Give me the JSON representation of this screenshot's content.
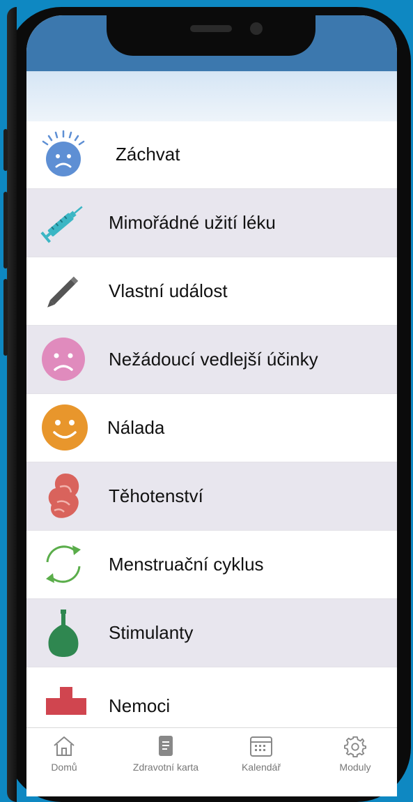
{
  "list": {
    "items": [
      {
        "label": "Záchvat",
        "icon": "seizure-face-icon"
      },
      {
        "label": "Mimořádné užití léku",
        "icon": "syringe-icon"
      },
      {
        "label": "Vlastní událost",
        "icon": "pencil-icon"
      },
      {
        "label": "Nežádoucí vedlejší účinky",
        "icon": "sad-face-icon"
      },
      {
        "label": "Nálada",
        "icon": "smile-face-icon"
      },
      {
        "label": "Těhotenství",
        "icon": "embryo-icon"
      },
      {
        "label": "Menstruační cyklus",
        "icon": "cycle-arrows-icon"
      },
      {
        "label": "Stimulanty",
        "icon": "bottle-icon"
      },
      {
        "label": "Nemoci",
        "icon": "medical-cross-icon"
      }
    ]
  },
  "tabbar": {
    "tabs": [
      {
        "label": "Domů",
        "icon": "home-icon"
      },
      {
        "label": "Zdravotní karta",
        "icon": "document-icon"
      },
      {
        "label": "Kalendář",
        "icon": "calendar-icon"
      },
      {
        "label": "Moduly",
        "icon": "gear-icon"
      }
    ]
  },
  "colors": {
    "background": "#0e88c2",
    "status_bar": "#3c78ae",
    "alt_row": "#e8e6ee",
    "seizure_blue": "#5e8fd4",
    "sad_pink": "#e08bbd",
    "mood_orange": "#e8962c",
    "embryo_red": "#d9635c",
    "cycle_green": "#5aad4a",
    "bottle_green": "#2f8750",
    "cross_red": "#d0454f"
  }
}
